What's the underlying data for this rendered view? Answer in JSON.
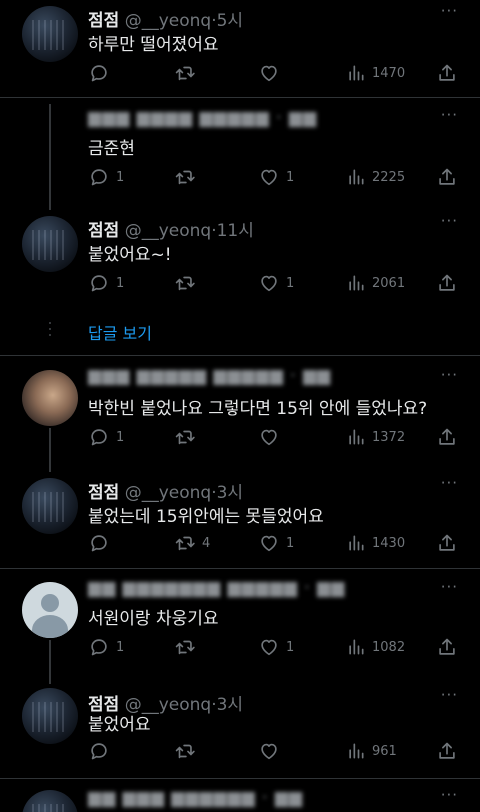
{
  "tweets": [
    {
      "name": "점점",
      "handle": "@__yeonq",
      "dot": "·",
      "time": "5시",
      "text": "하루만 떨어졌어요",
      "reply": "",
      "retweet": "",
      "like": "",
      "views": "1470"
    },
    {
      "name": "",
      "handle": "",
      "dot": "",
      "time": "",
      "text": "금준현",
      "reply": "1",
      "retweet": "",
      "like": "1",
      "views": "2225"
    },
    {
      "name": "점점",
      "handle": "@__yeonq",
      "dot": "·",
      "time": "11시",
      "text": "붙었어요~!",
      "reply": "1",
      "retweet": "",
      "like": "1",
      "views": "2061"
    },
    {
      "name": "",
      "handle": "",
      "dot": "",
      "time": "",
      "text": "박한빈 붙었나요 그렇다면 15위 안에 들었나요?",
      "reply": "1",
      "retweet": "",
      "like": "",
      "views": "1372"
    },
    {
      "name": "점점",
      "handle": "@__yeonq",
      "dot": "·",
      "time": "3시",
      "text": "붙었는데 15위안에는 못들었어요",
      "reply": "",
      "retweet": "4",
      "like": "1",
      "views": "1430"
    },
    {
      "name": "",
      "handle": "",
      "dot": "",
      "time": "",
      "text": "서원이랑 차웅기요",
      "reply": "1",
      "retweet": "",
      "like": "1",
      "views": "1082"
    },
    {
      "name": "점점",
      "handle": "@__yeonq",
      "dot": "·",
      "time": "3시",
      "text": "붙었어요",
      "reply": "",
      "retweet": "",
      "like": "",
      "views": "961"
    }
  ],
  "show_replies": "답글 보기",
  "more_icon": "···",
  "colors": {
    "background": "#000000",
    "text": "#e7e9ea",
    "muted": "#71767b",
    "link": "#1d9bf0",
    "separator": "#2f3336"
  }
}
